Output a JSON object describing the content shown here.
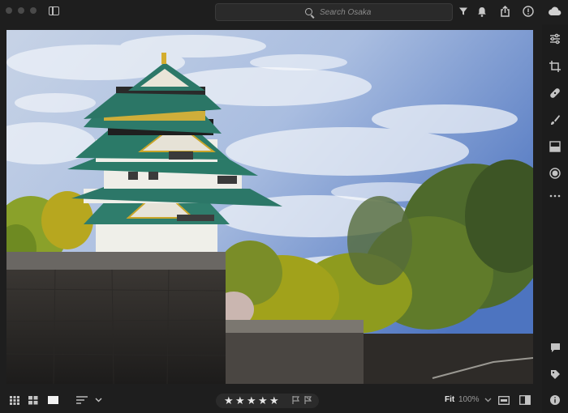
{
  "window": {
    "title": "Osaka"
  },
  "search": {
    "placeholder": "Search Osaka"
  },
  "toolbar_icons": [
    "sidebar-toggle-icon",
    "filter-icon",
    "bell-icon",
    "share-icon",
    "help-icon",
    "cloud-icon"
  ],
  "right_panel_tools": [
    "sliders-icon",
    "crop-icon",
    "healing-icon",
    "brush-icon",
    "gradient-icon",
    "radial-icon",
    "more-icon"
  ],
  "right_panel_bottom": [
    "comment-icon",
    "tag-icon",
    "info-icon"
  ],
  "view": {
    "fit_label": "Fit",
    "zoom_label": "100%"
  },
  "rating": {
    "stars": 5,
    "star_glyph": "★"
  },
  "colors": {
    "background": "#1e1e1e",
    "panel": "#1c1c1c",
    "search_bg": "#2a2a2a",
    "icon": "#c4c4c4"
  }
}
